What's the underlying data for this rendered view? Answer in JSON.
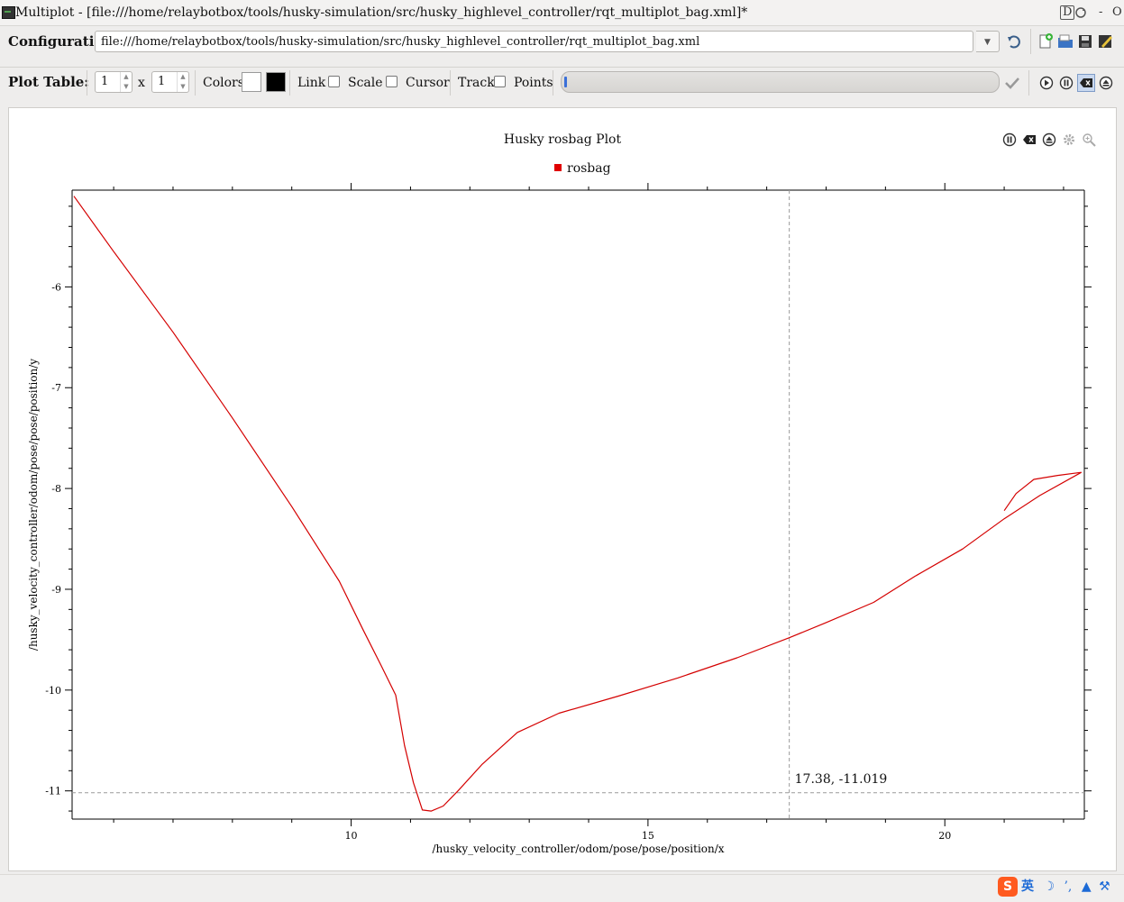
{
  "window": {
    "title": "Multiplot - [file:///home/relaybotbox/tools/husky-simulation/src/husky_highlevel_controller/rqt_multiplot_bag.xml]*",
    "buttons": [
      "D",
      "-",
      "O"
    ]
  },
  "config": {
    "label": "Configuration:",
    "path": "file:///home/relaybotbox/tools/husky-simulation/src/husky_highlevel_controller/rqt_multiplot_bag.xml"
  },
  "plot_table": {
    "label": "Plot Table:",
    "rows": "1",
    "x_sep": "x",
    "cols": "1",
    "colors_label": "Colors",
    "background_color": "#ffffff",
    "foreground_color": "#000000",
    "link_label": "Link",
    "scale_label": "Scale",
    "cursor_label": "Cursor",
    "track_label": "Track",
    "points_label": "Points",
    "progress": 0.01
  },
  "plot": {
    "title": "Husky rosbag Plot",
    "legend_label": "rosbag",
    "cursor_readout": "17.38, -11.019"
  },
  "chart_data": {
    "type": "line",
    "title": "Husky rosbag Plot",
    "xlabel": "/husky_velocity_controller/odom/pose/pose/position/x",
    "ylabel": "/husky_velocity_controller/odom/pose/pose/position/y",
    "xlim": [
      5.3,
      22.35
    ],
    "ylim": [
      -11.28,
      -5.04
    ],
    "x_ticks": [
      10,
      15,
      20
    ],
    "y_ticks": [
      -6,
      -7,
      -8,
      -9,
      -10,
      -11
    ],
    "legend": "top-center",
    "grid": false,
    "color": "#d40000",
    "cursor": {
      "x": 17.38,
      "y": -11.019
    },
    "series": [
      {
        "name": "rosbag",
        "points": [
          [
            5.33,
            -5.1
          ],
          [
            6.0,
            -5.65
          ],
          [
            7.0,
            -6.45
          ],
          [
            8.0,
            -7.3
          ],
          [
            9.0,
            -8.18
          ],
          [
            9.8,
            -8.92
          ],
          [
            10.2,
            -9.4
          ],
          [
            10.5,
            -9.75
          ],
          [
            10.75,
            -10.05
          ],
          [
            10.9,
            -10.55
          ],
          [
            11.05,
            -10.92
          ],
          [
            11.2,
            -11.19
          ],
          [
            11.35,
            -11.2
          ],
          [
            11.55,
            -11.15
          ],
          [
            11.8,
            -11.0
          ],
          [
            12.2,
            -10.74
          ],
          [
            12.8,
            -10.42
          ],
          [
            13.5,
            -10.23
          ],
          [
            14.5,
            -10.06
          ],
          [
            15.5,
            -9.88
          ],
          [
            16.5,
            -9.68
          ],
          [
            17.38,
            -9.48
          ],
          [
            18.0,
            -9.33
          ],
          [
            18.8,
            -9.13
          ],
          [
            19.5,
            -8.87
          ],
          [
            20.3,
            -8.6
          ],
          [
            21.0,
            -8.3
          ],
          [
            21.6,
            -8.07
          ],
          [
            22.3,
            -7.84
          ]
        ]
      },
      {
        "name": "rosbag",
        "points": [
          [
            21.0,
            -8.22
          ],
          [
            21.2,
            -8.05
          ],
          [
            21.5,
            -7.91
          ],
          [
            21.9,
            -7.87
          ],
          [
            22.3,
            -7.84
          ]
        ]
      }
    ]
  }
}
